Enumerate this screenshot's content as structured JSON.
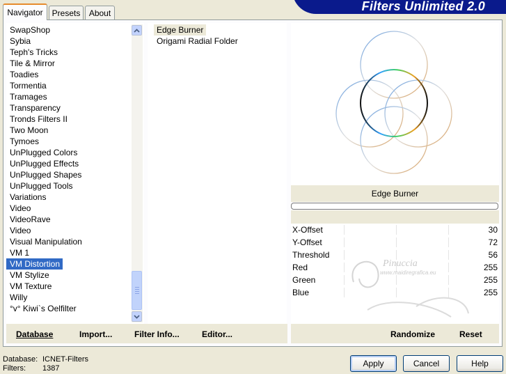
{
  "banner": {
    "title": "Filters Unlimited 2.0"
  },
  "tabs": [
    {
      "label": "Navigator"
    },
    {
      "label": "Presets"
    },
    {
      "label": "About"
    }
  ],
  "categories": [
    "SwapShop",
    "Sybia",
    "Teph's Tricks",
    "Tile & Mirror",
    "Toadies",
    "Tormentia",
    "Tramages",
    "Transparency",
    "Tronds Filters II",
    "Two Moon",
    "Tymoes",
    "UnPlugged Colors",
    "UnPlugged Effects",
    "UnPlugged Shapes",
    "UnPlugged Tools",
    "Variations",
    "Video",
    "VideoRave",
    "Video",
    "Visual Manipulation",
    "VM 1",
    "VM Distortion",
    "VM Stylize",
    "VM Texture",
    "Willy",
    "°v° Kiwi`s Oelfilter"
  ],
  "selected_category": "VM Distortion",
  "filters": [
    "Edge Burner",
    "Origami Radial Folder"
  ],
  "selected_filter": "Edge Burner",
  "preview": {
    "filter_name": "Edge Burner",
    "progress": 0
  },
  "params": [
    {
      "label": "X-Offset",
      "value": "30"
    },
    {
      "label": "Y-Offset",
      "value": "72"
    },
    {
      "label": "Threshold",
      "value": "56"
    },
    {
      "label": "Red",
      "value": "255"
    },
    {
      "label": "Green",
      "value": "255"
    },
    {
      "label": "Blue",
      "value": "255"
    }
  ],
  "watermark": {
    "name": "Pinuccia",
    "url": "www.maidiregrafica.eu"
  },
  "left_buttons": {
    "database": "Database",
    "import": "Import...",
    "filter_info": "Filter Info...",
    "editor": "Editor..."
  },
  "right_buttons": {
    "randomize": "Randomize",
    "reset": "Reset"
  },
  "dialog_buttons": {
    "apply": "Apply",
    "cancel": "Cancel",
    "help": "Help"
  },
  "status": {
    "database_label": "Database:",
    "database_value": "ICNET-Filters",
    "filters_label": "Filters:",
    "filters_value": "1387"
  }
}
